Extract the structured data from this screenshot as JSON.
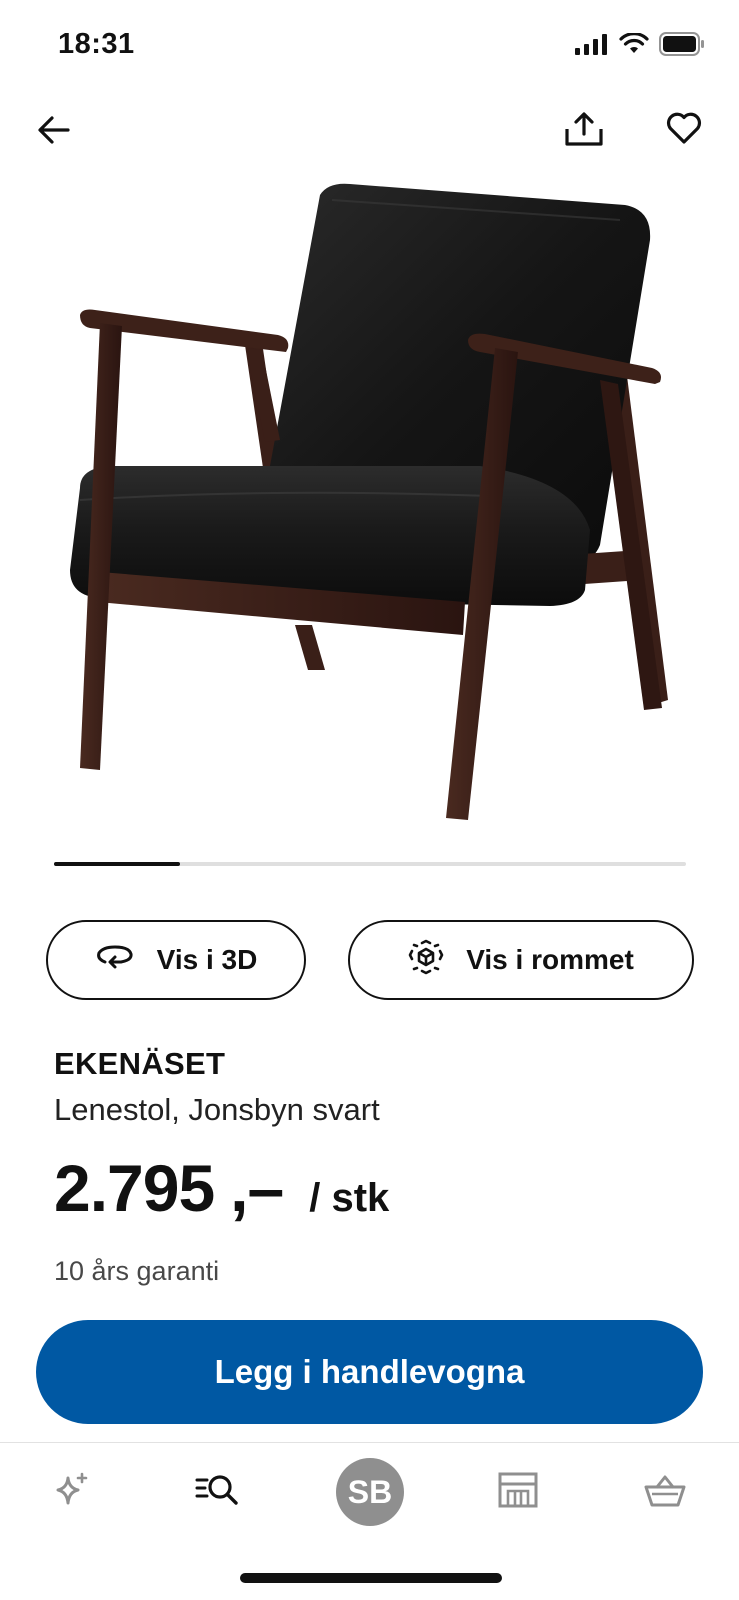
{
  "status_bar": {
    "time": "18:31",
    "icons": [
      "signal-icon",
      "wifi-icon",
      "battery-icon"
    ]
  },
  "nav": {
    "back_icon": "arrow-left-icon",
    "share_icon": "share-icon",
    "favorite_icon": "heart-icon"
  },
  "carousel": {
    "current_index": 1,
    "total_images": 5,
    "progress_fraction": 0.2
  },
  "actions": {
    "view_3d_label": "Vis i 3D",
    "view_3d_icon": "rotate-3d-icon",
    "view_room_label": "Vis i rommet",
    "view_room_icon": "ar-cube-icon"
  },
  "product": {
    "name": "EKENÄSET",
    "description": "Lenestol, Jonsbyn svart",
    "price": "2.795",
    "price_suffix": ",–",
    "price_unit": "/ stk",
    "warranty": "10 års garanti"
  },
  "cta": {
    "label": "Legg i handlevogna",
    "color": "#0058a3"
  },
  "tabbar": {
    "tabs": [
      {
        "name": "inspiration-icon"
      },
      {
        "name": "search-icon"
      },
      {
        "name": "profile-avatar",
        "initials": "SB"
      },
      {
        "name": "store-icon"
      },
      {
        "name": "basket-icon"
      }
    ]
  }
}
